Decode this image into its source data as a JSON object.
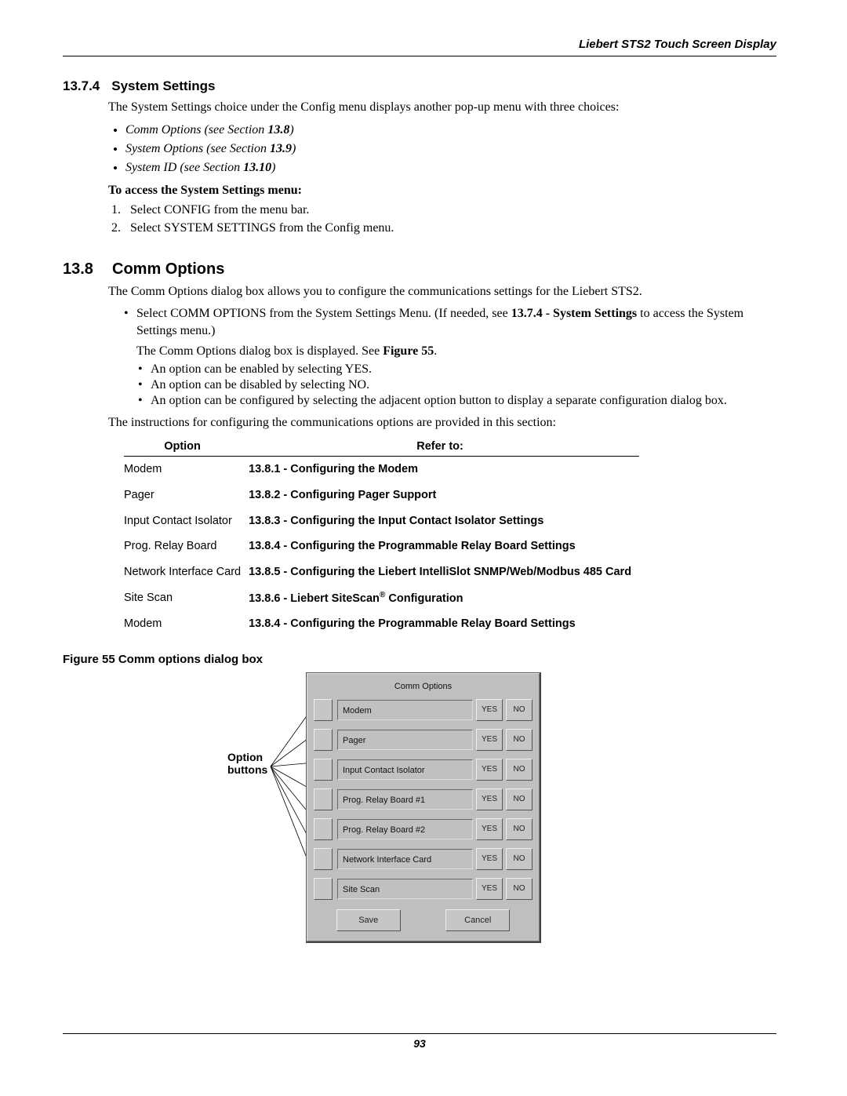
{
  "header": {
    "title": "Liebert STS2 Touch Screen Display"
  },
  "s1": {
    "num": "13.7.4",
    "title": "System Settings",
    "intro": "The System Settings choice under the Config menu displays another pop-up menu with three choices:",
    "items": [
      {
        "label": "Comm Options (see Section ",
        "ref": "13.8",
        "tail": ")"
      },
      {
        "label": "System Options (see Section ",
        "ref": "13.9",
        "tail": ")"
      },
      {
        "label": "System ID (see Section ",
        "ref": "13.10",
        "tail": ")"
      }
    ],
    "access_hdr": "To access the System Settings menu:",
    "steps": [
      "Select CONFIG from the menu bar.",
      "Select SYSTEM SETTINGS from the Config menu."
    ]
  },
  "s2": {
    "num": "13.8",
    "title": "Comm Options",
    "intro": "The Comm Options dialog box allows you to configure the communications settings for the Liebert STS2.",
    "b1a": "Select COMM OPTIONS from the System Settings Menu. (If needed, see ",
    "b1_ref": "13.7.4 - System Settings",
    "b1b": " to access the System Settings menu.)",
    "b2a": "The Comm Options dialog box is displayed. See ",
    "b2_ref": "Figure 55",
    "b2b": ".",
    "subs": [
      "An option can be enabled by selecting YES.",
      "An option can be disabled by selecting NO.",
      "An option can be configured by selecting the adjacent option button to display a separate configuration dialog box."
    ],
    "outro": "The instructions for configuring the communications options are provided in this section:"
  },
  "table": {
    "h1": "Option",
    "h2": "Refer to:",
    "rows": [
      {
        "opt": "Modem",
        "ref": "13.8.1 - Configuring the Modem"
      },
      {
        "opt": "Pager",
        "ref": "13.8.2 - Configuring Pager Support"
      },
      {
        "opt": "Input Contact Isolator",
        "ref": "13.8.3 - Configuring the Input Contact Isolator Settings"
      },
      {
        "opt": "Prog. Relay Board",
        "ref": "13.8.4 - Configuring the Programmable Relay Board Settings"
      },
      {
        "opt": "Network Interface Card",
        "ref": "13.8.5 - Configuring the Liebert IntelliSlot SNMP/Web/Modbus 485 Card"
      },
      {
        "opt": "Site Scan",
        "ref_html": "13.8.6 - Liebert SiteScan<sup>®</sup> Configuration"
      },
      {
        "opt": "Modem",
        "ref": "13.8.4 - Configuring the Programmable Relay Board Settings"
      }
    ]
  },
  "figure": {
    "caption": "Figure 55  Comm options dialog box",
    "annot1": "Option",
    "annot2": "buttons",
    "dlg_title": "Comm Options",
    "options": [
      "Modem",
      "Pager",
      "Input Contact Isolator",
      "Prog. Relay Board #1",
      "Prog. Relay Board #2",
      "Network Interface Card",
      "Site Scan"
    ],
    "yes": "YES",
    "no": "NO",
    "save": "Save",
    "cancel": "Cancel"
  },
  "page_num": "93"
}
